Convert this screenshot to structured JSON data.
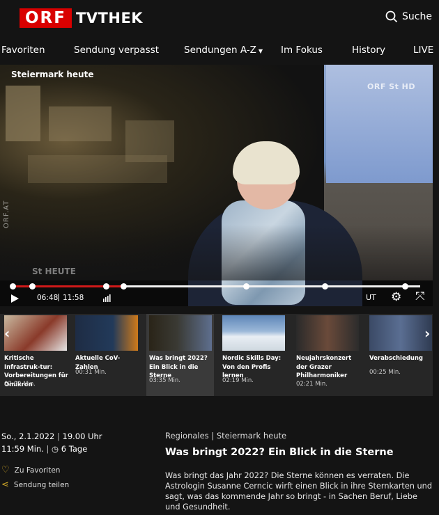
{
  "header": {
    "logo_orf": "ORF",
    "logo_tv": "TVTHEK",
    "search_label": "Suche"
  },
  "nav": {
    "items": [
      "Favoriten",
      "Sendung verpasst",
      "Sendungen A-Z",
      "Im Fokus",
      "History",
      "LIVE"
    ]
  },
  "player": {
    "show_title": "Steiermark heute",
    "watermark_vertical": "ORF.AT",
    "channel_logo": "ORF St HD",
    "lower_logo": "St HEUTE",
    "current_time": "06:48",
    "duration": "11:58",
    "progress_fraction": 0.27,
    "subtitle_label": "UT"
  },
  "carousel": {
    "items": [
      {
        "title": "Kritische Infrastruk-tur: Vorbereitungen für Omikron",
        "duration": "02:09 Min."
      },
      {
        "title": "Aktuelle CoV-Zahlen",
        "duration": "00:31 Min."
      },
      {
        "title": "Was bringt 2022? Ein Blick in die Sterne",
        "duration": "03:35 Min."
      },
      {
        "title": "Nordic Skills Day: Von den Profis lernen",
        "duration": "02:19 Min."
      },
      {
        "title": "Neujahrskonzert der Grazer Philharmoniker",
        "duration": "02:21 Min."
      },
      {
        "title": "Verabschiedung",
        "duration": "00:25 Min."
      }
    ]
  },
  "info": {
    "date": "So., 2.1.2022",
    "time": "19.00 Uhr",
    "length": "11:59 Min.",
    "availability": "6 Tage",
    "favorite": "Zu Favoriten",
    "share": "Sendung teilen",
    "category": "Regionales | Steiermark heute",
    "title": "Was bringt 2022? Ein Blick in die Sterne",
    "description": "Was bringt das Jahr 2022? Die Sterne können es verraten. Die Astrologin Susanne Cerncic wirft einen Blick in ihre Sternkarten und sagt, was das kommende Jahr so bringt - in Sachen Beruf, Liebe und Gesundheit."
  }
}
